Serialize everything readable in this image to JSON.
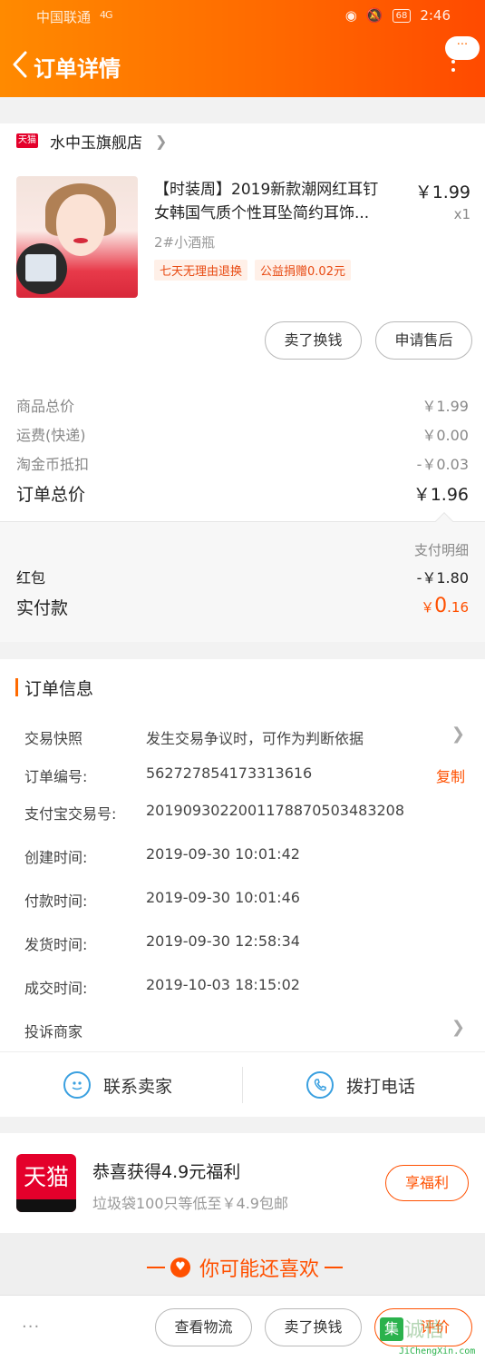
{
  "status_bar": {
    "carrier": "中国联通",
    "signal": "4G",
    "battery": "68",
    "time": "2:46"
  },
  "nav": {
    "title": "订单详情",
    "more_label": "···"
  },
  "store": {
    "badge": "天猫",
    "name": "水中玉旗舰店"
  },
  "item": {
    "title_line1": "【时装周】2019新款潮网红耳钉",
    "title_line2": "女韩国气质个性耳坠简约耳饰...",
    "price": "￥1.99",
    "quantity": "x1",
    "sku": "2#小酒瓶",
    "tags": [
      "七天无理由退换",
      "公益捐赠0.02元"
    ],
    "actions": [
      "卖了换钱",
      "申请售后"
    ]
  },
  "summary": {
    "goods_label": "商品总价",
    "goods_value": "￥1.99",
    "shipping_label": "运费(快递)",
    "shipping_value": "￥0.00",
    "coin_label": "淘金币抵扣",
    "coin_value": "-￥0.03",
    "total_label": "订单总价",
    "total_value": "￥1.96"
  },
  "payment": {
    "detail_link": "支付明细",
    "redpacket_label": "红包",
    "redpacket_value": "-￥1.80",
    "paid_label": "实付款",
    "paid_currency": "￥",
    "paid_int": "0",
    "paid_dec": ".16"
  },
  "order_info": {
    "title": "订单信息",
    "snapshot_label": "交易快照",
    "snapshot_value": "发生交易争议时，可作为判断依据",
    "order_no_label": "订单编号:",
    "order_no": "562727854173313616",
    "copy_label": "复制",
    "alipay_label": "支付宝交易号:",
    "alipay_no": "2019093022001178870503483208",
    "created_label": "创建时间:",
    "created": "2019-09-30 10:01:42",
    "paid_label": "付款时间:",
    "paid": "2019-09-30 10:01:46",
    "shipped_label": "发货时间:",
    "shipped": "2019-09-30 12:58:34",
    "completed_label": "成交时间:",
    "completed": "2019-10-03 18:15:02",
    "complain_label": "投诉商家"
  },
  "contact": {
    "seller": "联系卖家",
    "call": "拨打电话"
  },
  "promo": {
    "logo": "天猫",
    "title": "恭喜获得4.9元福利",
    "subtitle": "垃圾袋100只等低至￥4.9包邮",
    "button": "享福利"
  },
  "recommend": {
    "title": "你可能还喜欢"
  },
  "bottom_bar": {
    "more": "···",
    "logistics": "查看物流",
    "sell": "卖了换钱",
    "rate": "评价"
  },
  "watermark": {
    "mark": "集",
    "text": "诚信",
    "url": "JiChengXin.com"
  },
  "colors": {
    "accent": "#ff5000",
    "header_start": "#ff8a00",
    "header_end": "#ff4a00",
    "tmall_red": "#e4002b"
  }
}
